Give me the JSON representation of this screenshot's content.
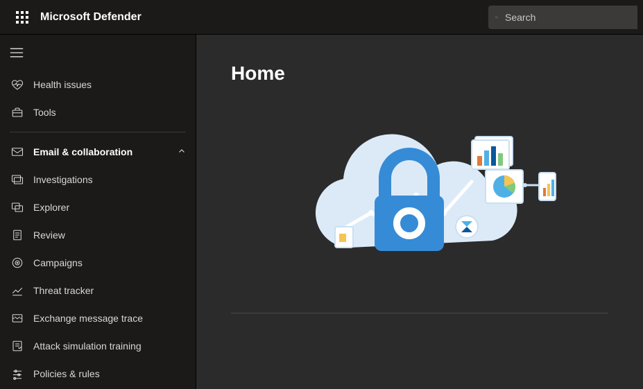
{
  "header": {
    "app_title": "Microsoft Defender",
    "search_placeholder": "Search"
  },
  "sidebar": {
    "top": [
      {
        "label": "Health issues"
      },
      {
        "label": "Tools"
      }
    ],
    "section": {
      "label": "Email & collaboration"
    },
    "items": [
      {
        "label": "Investigations"
      },
      {
        "label": "Explorer"
      },
      {
        "label": "Review"
      },
      {
        "label": "Campaigns"
      },
      {
        "label": "Threat tracker"
      },
      {
        "label": "Exchange message trace"
      },
      {
        "label": "Attack simulation training"
      },
      {
        "label": "Policies & rules"
      }
    ]
  },
  "main": {
    "title": "Home"
  }
}
